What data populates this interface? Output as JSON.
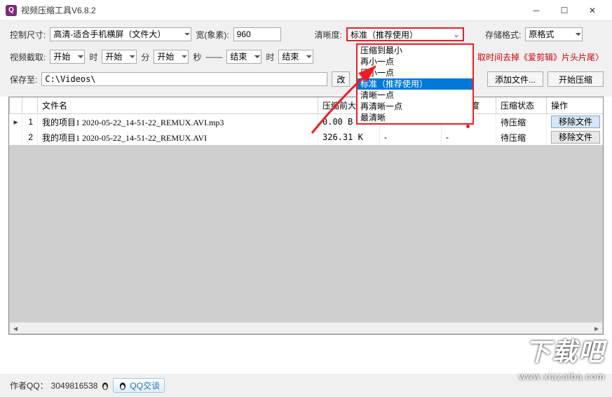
{
  "window": {
    "title": "视频压缩工具V6.8.2"
  },
  "row1": {
    "size_label": "控制尺寸:",
    "size_value": "高清-适合手机横屏（文件大）",
    "width_label": "宽(象素):",
    "width_value": "960",
    "clarity_label": "清晰度:",
    "clarity_selected": "标准（推荐使用）",
    "save_fmt_label": "存储格式:",
    "save_fmt_value": "原格式"
  },
  "clarity_options": [
    "压缩到最小",
    "再小一点",
    "压小一点",
    "标准（推荐使用）",
    "清晰一点",
    "再清晰一点",
    "最清晰"
  ],
  "row2": {
    "cut_label": "视频截取:",
    "start1": "开始",
    "u_hour": "时",
    "start2": "开始",
    "u_min": "分",
    "start3": "开始",
    "u_sec": "秒",
    "sep": "——",
    "end1": "结束",
    "u_hour2": "时",
    "end2": "结束",
    "tip": "取时间去掉《爱剪辑》片头片尾〉"
  },
  "row3": {
    "saveto_label": "保存至:",
    "saveto_path": "C:\\Videos\\",
    "change_btn": "改",
    "add_btn": "添加文件...",
    "start_btn": "开始压缩"
  },
  "table": {
    "headers": [
      "",
      "",
      "文件名",
      "压缩前大小",
      "压缩后大小",
      "压缩进度",
      "压缩状态",
      "操作"
    ],
    "rows": [
      {
        "idx": "1",
        "name": "我的项目1 2020-05-22_14-51-22_REMUX.AVI.mp3",
        "before": "0.00 B",
        "after": "-",
        "progress": "-",
        "status": "待压缩",
        "op": "移除文件",
        "indicator": "▸",
        "active": true
      },
      {
        "idx": "2",
        "name": "我的项目1 2020-05-22_14-51-22_REMUX.AVI",
        "before": "326.31 K",
        "after": "-",
        "progress": "-",
        "status": "待压缩",
        "op": "移除文件",
        "indicator": "",
        "active": false
      }
    ]
  },
  "footer": {
    "author_label": "作者QQ：",
    "author_qq": "3049816538",
    "qq_btn": "QQ交谈"
  },
  "watermark": {
    "big": "下载吧",
    "url": "www.xiazaiba.com"
  }
}
